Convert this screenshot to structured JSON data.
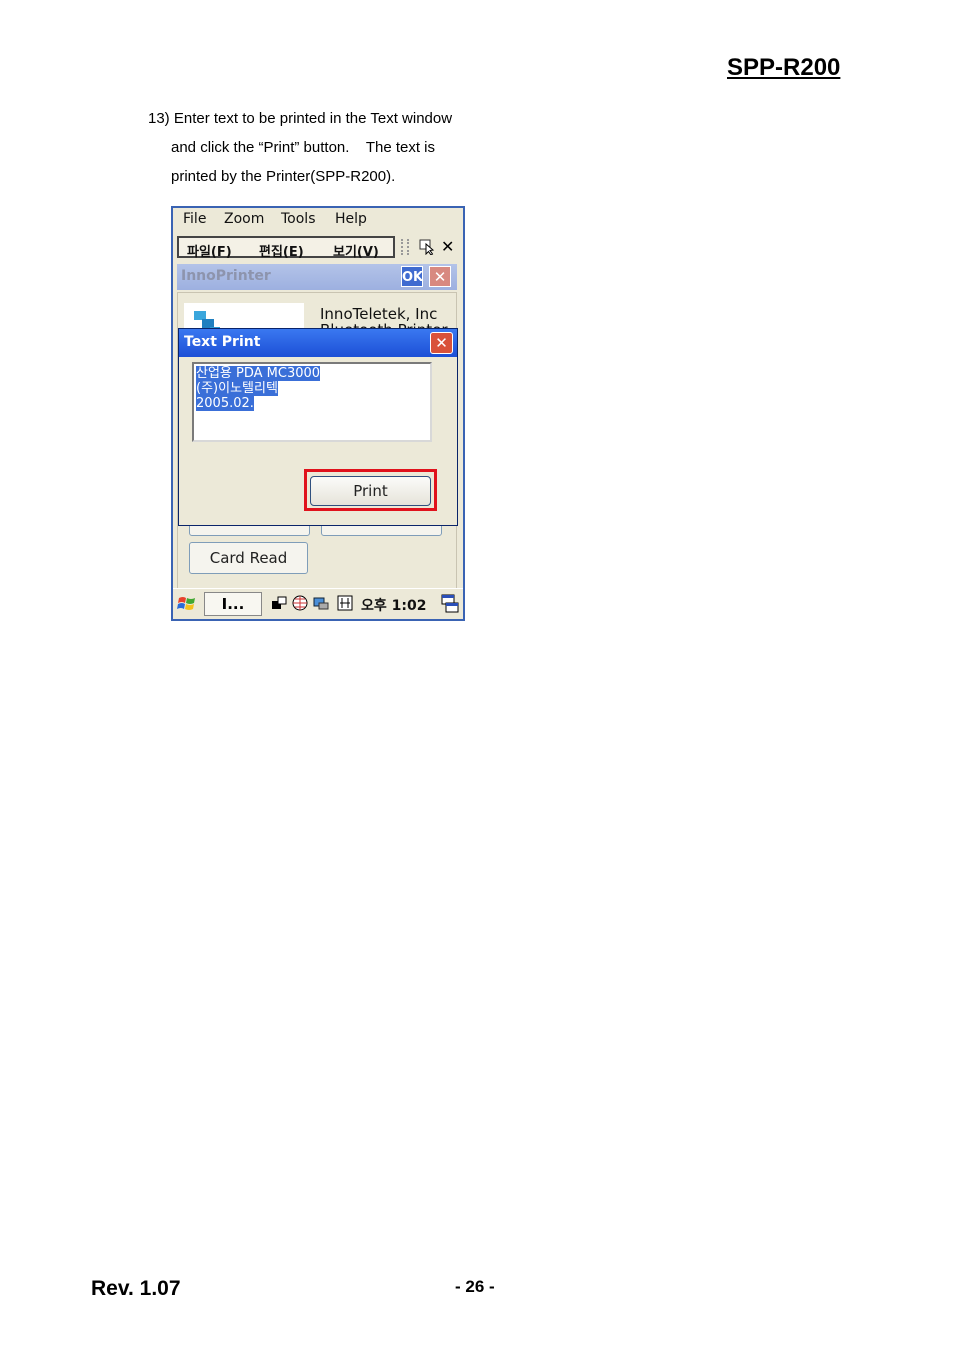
{
  "header": {
    "doc_title": "SPP-R200"
  },
  "instructions": {
    "line1": "13) Enter text to be printed in the Text window",
    "line2": "and click the “Print” button.    The text is",
    "line3": "printed by the Printer(SPP-R200)."
  },
  "screenshot": {
    "ie_menu": {
      "file": "File",
      "zoom": "Zoom",
      "tools": "Tools",
      "help": "Help"
    },
    "app_menu": {
      "file": "파일(F)",
      "edit": "편집(E)",
      "view": "보기(V)"
    },
    "app_window": {
      "title": "InnoPrinter",
      "ok_label": "OK",
      "company_line1": "InnoTeletek, Inc",
      "company_line2": "Bluetooth Printer",
      "card_read_label": "Card Read"
    },
    "dialog": {
      "title": "Text Print",
      "text_lines": [
        "산업용 PDA MC3000",
        "(주)이노텔리텍",
        "2005.02."
      ],
      "print_label": "Print"
    },
    "taskbar": {
      "task_label": "I...",
      "clock": "오후  1:02"
    },
    "colors": {
      "highlight": "#e0121c",
      "title_blue": "#1c4fd6",
      "selection": "#3a6fd8"
    }
  },
  "footer": {
    "revision": "Rev. 1.07",
    "page_number": "- 26 -"
  }
}
